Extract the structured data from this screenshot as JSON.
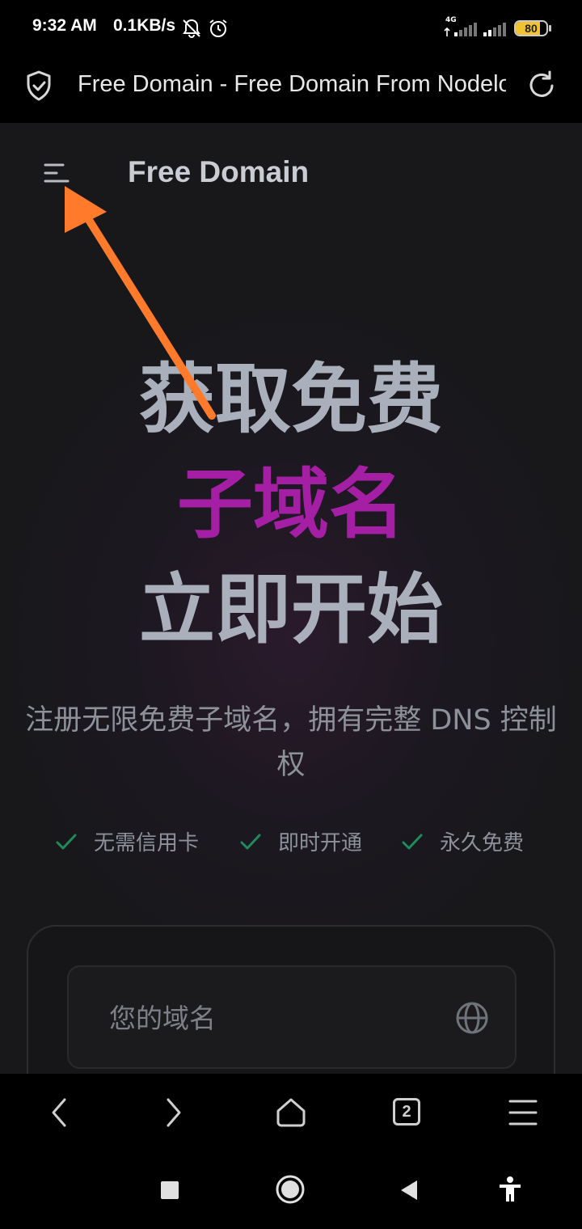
{
  "status_bar": {
    "time": "9:32 AM",
    "net_speed": "0.1KB/s",
    "network_type": "4G",
    "battery": "80",
    "battery_level": 0.8,
    "icons": [
      "mute-bell-icon",
      "alarm-icon",
      "signal-4g-icon",
      "signal-icon",
      "battery-icon"
    ]
  },
  "browser": {
    "page_title": "Free Domain - Free Domain From Nodeloc",
    "tab_count": "2"
  },
  "page": {
    "brand": "Free Domain",
    "hero": {
      "line1": "获取免费",
      "line2": "子域名",
      "line3": "立即开始"
    },
    "subtitle": "注册无限免费子域名，拥有完整 DNS 控制权",
    "features": [
      "无需信用卡",
      "即时开通",
      "永久免费"
    ],
    "domain_input": {
      "placeholder": "您的域名",
      "value": ""
    }
  },
  "colors": {
    "accent": "#a51fa5",
    "arrow": "#ff7a2a",
    "check": "#1f8a5b",
    "page_bg": "#18181b"
  }
}
